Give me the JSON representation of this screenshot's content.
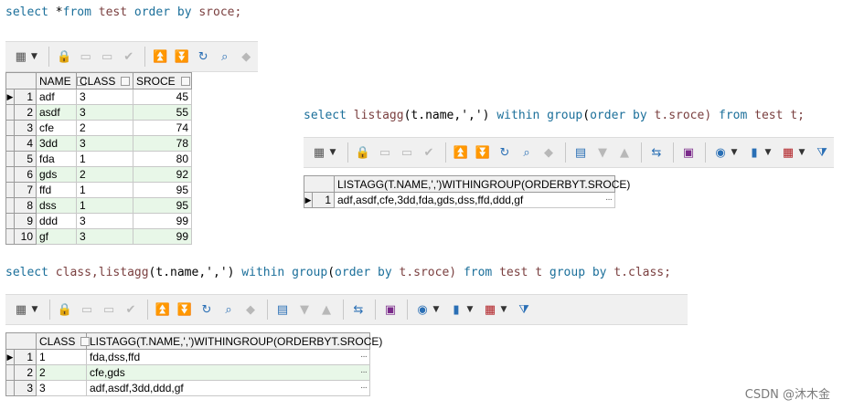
{
  "query1": {
    "tokens": [
      {
        "t": "select",
        "c": "kw"
      },
      {
        "t": " *",
        "c": "pl"
      },
      {
        "t": "from",
        "c": "kw"
      },
      {
        "t": " test ",
        "c": "ob"
      },
      {
        "t": "order by",
        "c": "kw"
      },
      {
        "t": " sroce;",
        "c": "ob"
      }
    ]
  },
  "query2": {
    "tokens": [
      {
        "t": "select ",
        "c": "kw"
      },
      {
        "t": "listagg",
        "c": "ob"
      },
      {
        "t": "(t.name,',')",
        "c": "pl"
      },
      {
        "t": " within group",
        "c": "kw"
      },
      {
        "t": "(",
        "c": "pl"
      },
      {
        "t": "order by",
        "c": "kw"
      },
      {
        "t": " t.sroce) ",
        "c": "ob"
      },
      {
        "t": "from",
        "c": "kw"
      },
      {
        "t": " test t;",
        "c": "ob"
      }
    ]
  },
  "query3": {
    "tokens": [
      {
        "t": "select ",
        "c": "kw"
      },
      {
        "t": "class,listagg",
        "c": "ob"
      },
      {
        "t": "(t.name,',')",
        "c": "pl"
      },
      {
        "t": " within group",
        "c": "kw"
      },
      {
        "t": "(",
        "c": "pl"
      },
      {
        "t": "order by",
        "c": "kw"
      },
      {
        "t": " t.sroce) ",
        "c": "ob"
      },
      {
        "t": "from",
        "c": "kw"
      },
      {
        "t": " test t ",
        "c": "ob"
      },
      {
        "t": "group by",
        "c": "kw"
      },
      {
        "t": " t.class;",
        "c": "ob"
      }
    ]
  },
  "grid1": {
    "columns": [
      "NAME",
      "CLASS",
      "SROCE"
    ],
    "rows": [
      [
        "1",
        "adf",
        "3",
        "45"
      ],
      [
        "2",
        "asdf",
        "3",
        "55"
      ],
      [
        "3",
        "cfe",
        "2",
        "74"
      ],
      [
        "4",
        "3dd",
        "3",
        "78"
      ],
      [
        "5",
        "fda",
        "1",
        "80"
      ],
      [
        "6",
        "gds",
        "2",
        "92"
      ],
      [
        "7",
        "ffd",
        "1",
        "95"
      ],
      [
        "8",
        "dss",
        "1",
        "95"
      ],
      [
        "9",
        "ddd",
        "3",
        "99"
      ],
      [
        "10",
        "gf",
        "3",
        "99"
      ]
    ]
  },
  "grid2": {
    "columns": [
      "LISTAGG(T.NAME,',')WITHINGROUP(ORDERBYT.SROCE)"
    ],
    "rows": [
      [
        "1",
        "adf,asdf,cfe,3dd,fda,gds,dss,ffd,ddd,gf"
      ]
    ]
  },
  "grid3": {
    "columns": [
      "CLASS",
      "LISTAGG(T.NAME,',')WITHINGROUP(ORDERBYT.SROCE)"
    ],
    "rows": [
      [
        "1",
        "1",
        "fda,dss,ffd"
      ],
      [
        "2",
        "2",
        "cfe,gds"
      ],
      [
        "3",
        "3",
        "adf,asdf,3dd,ddd,gf"
      ]
    ]
  },
  "watermark": "CSDN @沐木金",
  "icons": {
    "short": [
      "grid-icon",
      "lock-icon",
      "new-record-icon",
      "delete-record-icon",
      "post-icon",
      "first-icon",
      "last-icon",
      "refresh-icon",
      "find-icon",
      "clear-icon"
    ],
    "long": [
      "grid-icon",
      "lock-icon",
      "new-record-icon",
      "delete-record-icon",
      "post-icon",
      "first-icon",
      "last-icon",
      "refresh-icon",
      "find-icon",
      "clear-icon",
      "record-icon",
      "sort-down-icon",
      "sort-up-icon",
      "connect-icon",
      "save-icon",
      "query-icon",
      "chart-icon",
      "table-icon",
      "filter-icon"
    ]
  }
}
